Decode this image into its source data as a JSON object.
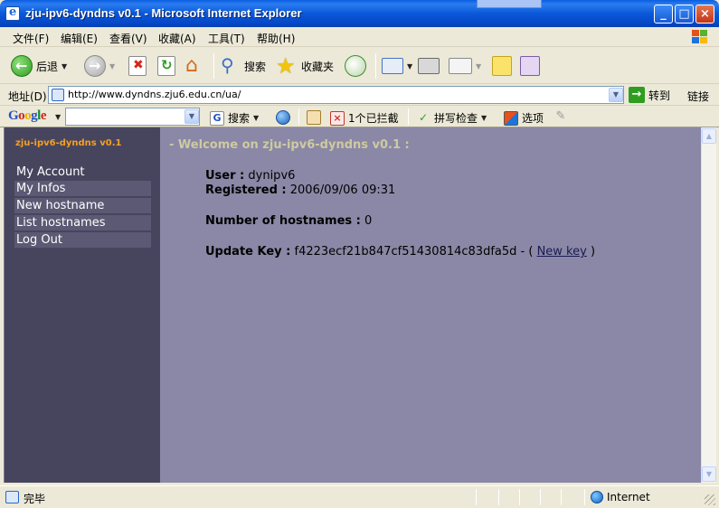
{
  "window": {
    "title": "zju-ipv6-dyndns v0.1 - Microsoft Internet Explorer",
    "minimize": "_",
    "maximize": "□",
    "close": "×"
  },
  "menu": {
    "items": [
      "文件(F)",
      "编辑(E)",
      "查看(V)",
      "收藏(A)",
      "工具(T)",
      "帮助(H)"
    ]
  },
  "toolbar": {
    "back_label": "后退",
    "search_label": "搜索",
    "favorites_label": "收藏夹"
  },
  "address": {
    "label": "地址(D)",
    "url": "http://www.dyndns.zju6.edu.cn/ua/",
    "go_label": "转到",
    "links_label": "链接"
  },
  "google_bar": {
    "logo": "Google",
    "search_label": "搜索",
    "blocked_label": "1个已拦截",
    "spellcheck_label": "拼写检查",
    "options_label": "选项"
  },
  "sidebar": {
    "site_title": "zju-ipv6-dyndns v0.1",
    "nav": [
      "My Account",
      "My Infos",
      "New hostname",
      "List hostnames",
      "Log Out"
    ]
  },
  "main": {
    "welcome": "- Welcome on zju-ipv6-dyndns v0.1 :",
    "user_label": "User :",
    "user_value": "dynipv6",
    "registered_label": "Registered :",
    "registered_value": "2006/09/06 09:31",
    "hostnames_label": "Number of hostnames :",
    "hostnames_value": "0",
    "update_key_label": "Update Key :",
    "update_key_value": "f4223ecf21b847cf51430814c83dfa5d - (",
    "new_key_link": "New key",
    "close_paren": ")"
  },
  "status": {
    "text": "完毕",
    "zone": "Internet"
  },
  "colors": {
    "sidebar_bg": "#47455e",
    "content_bg": "#8a88a6",
    "site_title": "#f4a022",
    "welcome": "#cfc9a0"
  }
}
